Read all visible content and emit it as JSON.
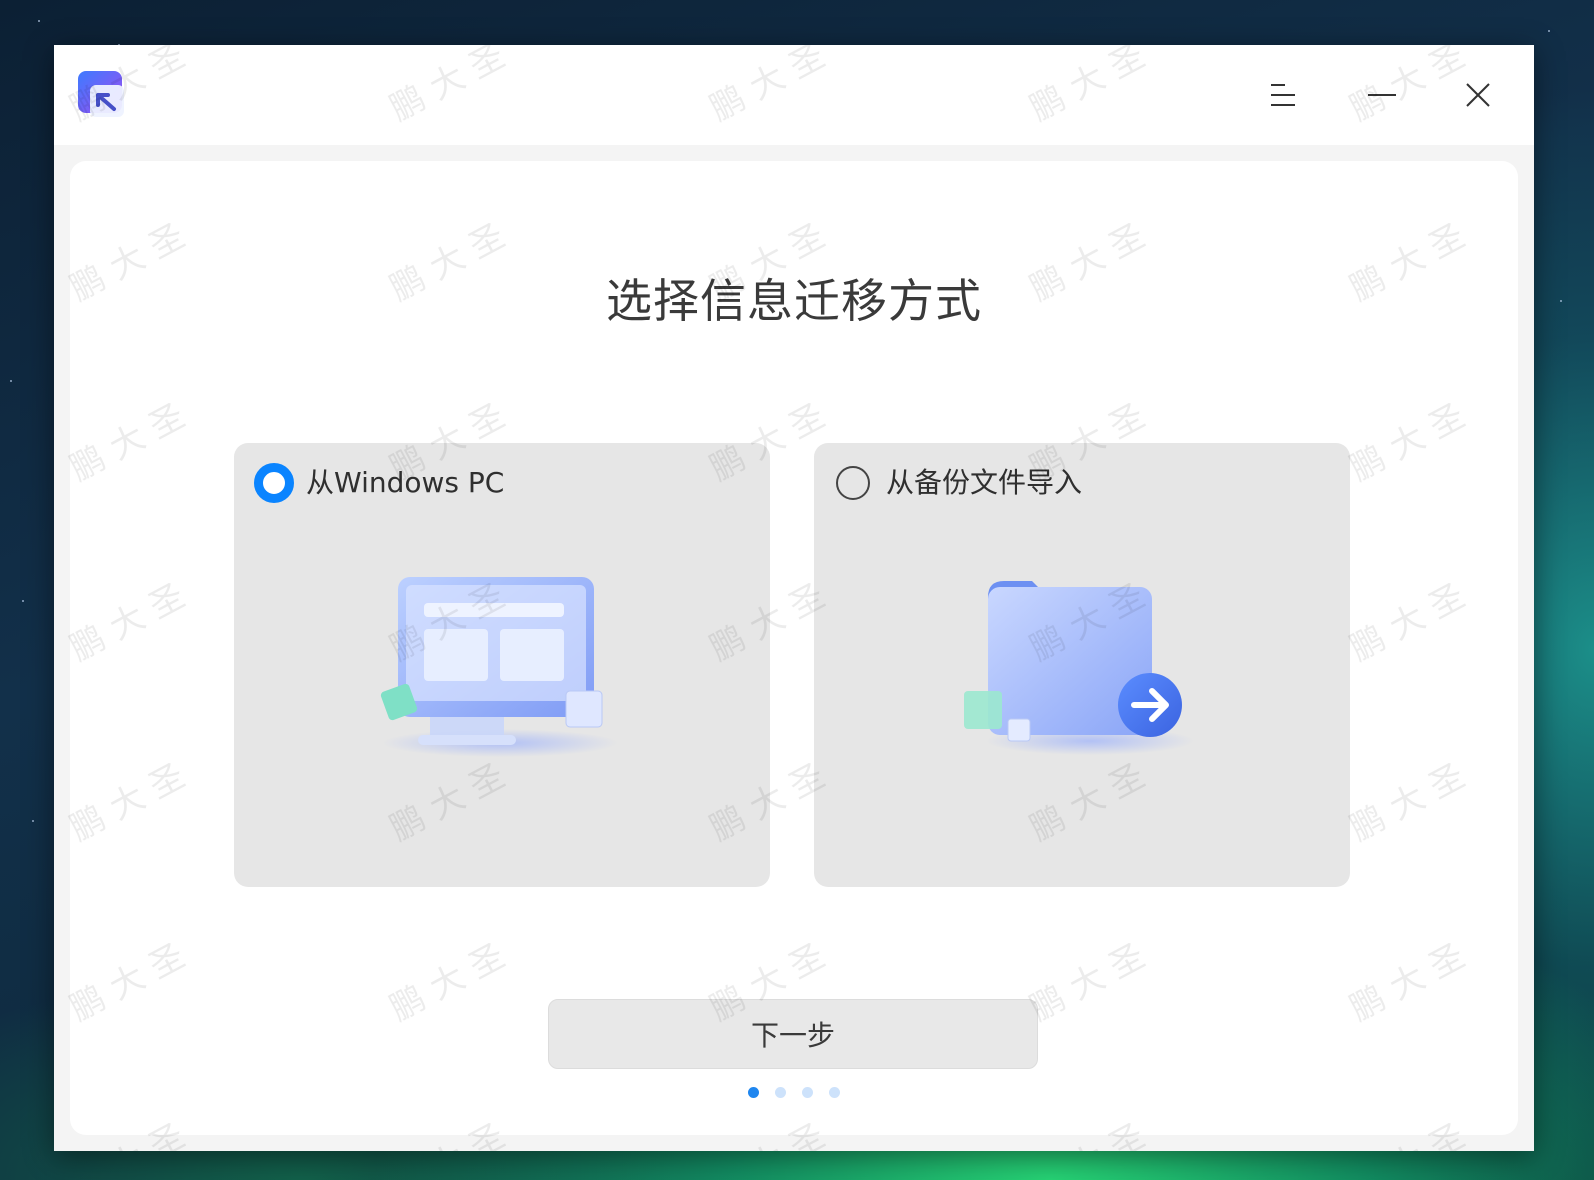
{
  "window": {
    "app_icon": "data-migration-app-icon",
    "menu_icon": "hamburger-menu-icon",
    "minimize_icon": "minimize-icon",
    "close_icon": "close-icon"
  },
  "main": {
    "title": "选择信息迁移方式",
    "options": [
      {
        "label": "从Windows PC",
        "selected": true,
        "illustration": "monitor-icon"
      },
      {
        "label": "从备份文件导入",
        "selected": false,
        "illustration": "folder-arrow-icon"
      }
    ],
    "next_label": "下一步",
    "pager": {
      "total": 4,
      "current": 1
    }
  },
  "watermark": "鹏 大 圣",
  "colors": {
    "accent": "#0a84ff",
    "card_bg": "#e6e6e6",
    "title": "#3a3a3a"
  }
}
